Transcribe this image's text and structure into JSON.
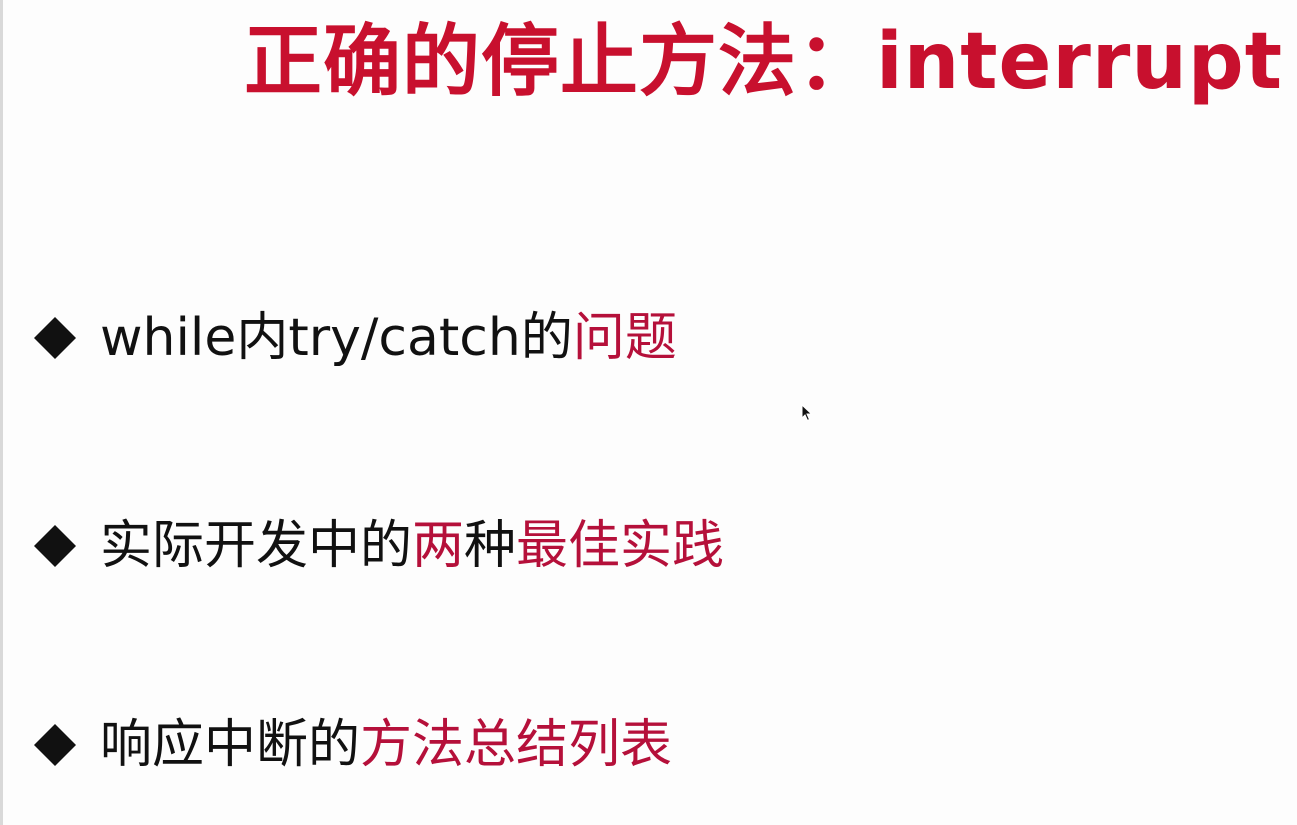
{
  "slide": {
    "title": "正确的停止方法：interrupt",
    "colors": {
      "title": "#c8102e",
      "highlight": "#b5103a",
      "text": "#111111",
      "background": "#fdfdfd"
    },
    "bullet_icon": "diamond-icon",
    "bullets": [
      {
        "plain": "while内try/catch的",
        "highlight": "问题"
      },
      {
        "plain": "实际开发中的",
        "highlight_a": "两",
        "middle": "种",
        "highlight_b": "最佳实践"
      },
      {
        "plain": "响应中断的",
        "highlight": "方法总结列表"
      }
    ],
    "cursor_icon": "mouse-pointer-icon"
  }
}
